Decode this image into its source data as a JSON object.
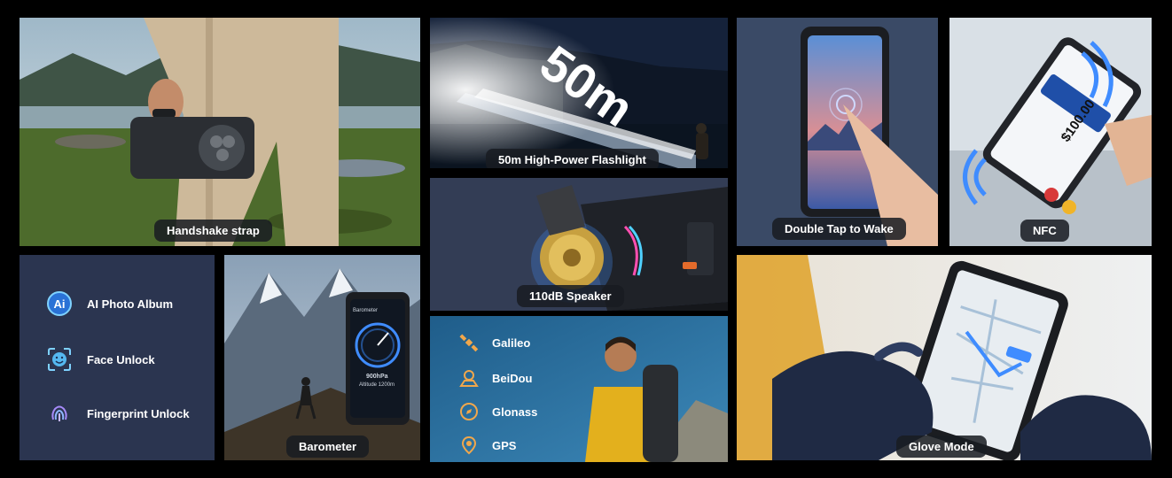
{
  "tiles": {
    "handshake": {
      "label": "Handshake strap"
    },
    "flashlight": {
      "label": "50m High-Power Flashlight",
      "distance_text": "50m"
    },
    "double_tap": {
      "label": "Double Tap to Wake"
    },
    "nfc": {
      "label": "NFC",
      "amount": "$100.00"
    },
    "speaker": {
      "label": "110dB Speaker"
    },
    "features": {
      "items": [
        {
          "label": "AI Photo Album",
          "icon": "ai-icon"
        },
        {
          "label": "Face Unlock",
          "icon": "face-unlock-icon"
        },
        {
          "label": "Fingerprint Unlock",
          "icon": "fingerprint-icon"
        }
      ]
    },
    "barometer": {
      "label": "Barometer",
      "screen_title": "Barometer",
      "pressure": "900hPa",
      "altitude": "Altitude 1200m"
    },
    "gnss": {
      "items": [
        {
          "label": "Galileo",
          "icon": "satellite-icon"
        },
        {
          "label": "BeiDou",
          "icon": "beidou-icon"
        },
        {
          "label": "Glonass",
          "icon": "compass-icon"
        },
        {
          "label": "GPS",
          "icon": "location-pin-icon"
        }
      ]
    },
    "glove": {
      "label": "Glove Mode"
    }
  },
  "colors": {
    "accent_blue": "#3f8cff",
    "tile_navy": "#2b3550",
    "pill_bg": "#1b1e24"
  }
}
